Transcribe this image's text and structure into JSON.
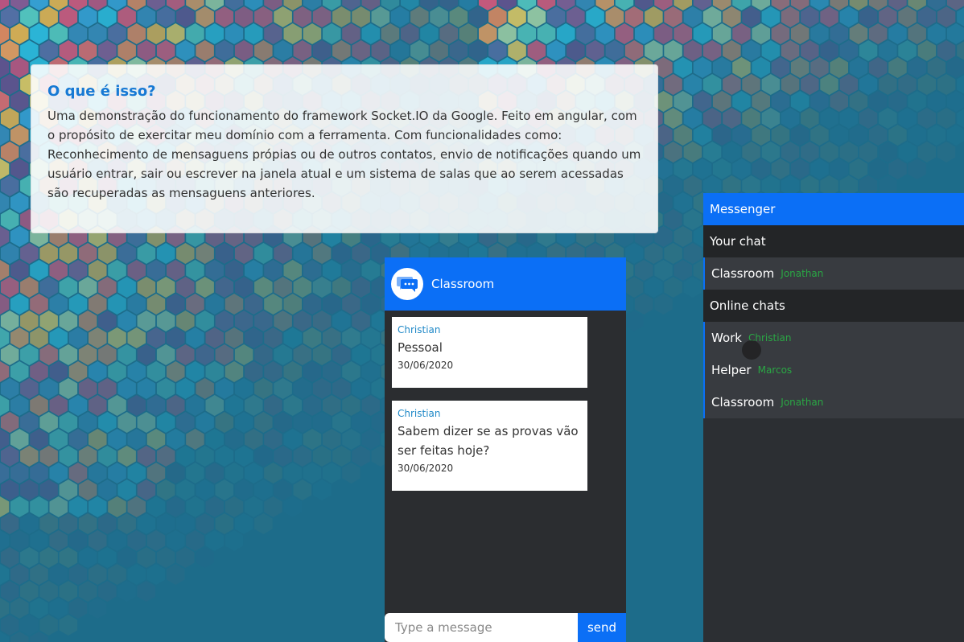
{
  "info": {
    "title": "O que é isso?",
    "body": "Uma demonstração do funcionamento do framework Socket.IO da Google. Feito em angular, com o propósito de exercitar meu domínio com a ferramenta. Com funcionalidades como: Reconhecimento de mensaguens própias ou de outros contatos, envio de notificações quando um usuário entrar, sair ou escrever na janela atual e um sistema de salas que ao serem acessadas são recuperadas as mensaguens anteriores."
  },
  "chat": {
    "room": "Classroom",
    "avatar_icon": "chat-bubbles-icon",
    "messages": [
      {
        "author": "Christian",
        "text": "Pessoal",
        "date": "30/06/2020"
      },
      {
        "author": "Christian",
        "text": "Sabem dizer se as provas vão ser feitas hoje?",
        "date": "30/06/2020"
      }
    ],
    "input_placeholder": "Type a message",
    "send_label": "send"
  },
  "messenger": {
    "title": "Messenger",
    "your_chat_label": "Your chat",
    "your_chats": [
      {
        "room": "Classroom",
        "user": "Jonathan"
      }
    ],
    "online_label": "Online chats",
    "online_chats": [
      {
        "room": "Work",
        "user": "Christian"
      },
      {
        "room": "Helper",
        "user": "Marcos"
      },
      {
        "room": "Classroom",
        "user": "Jonathan"
      }
    ]
  },
  "colors": {
    "accent": "#0b6ff6",
    "panel": "#2c2f33",
    "author_link": "#1e88c7",
    "user_green": "#2aa744",
    "title_blue": "#1779d4"
  }
}
